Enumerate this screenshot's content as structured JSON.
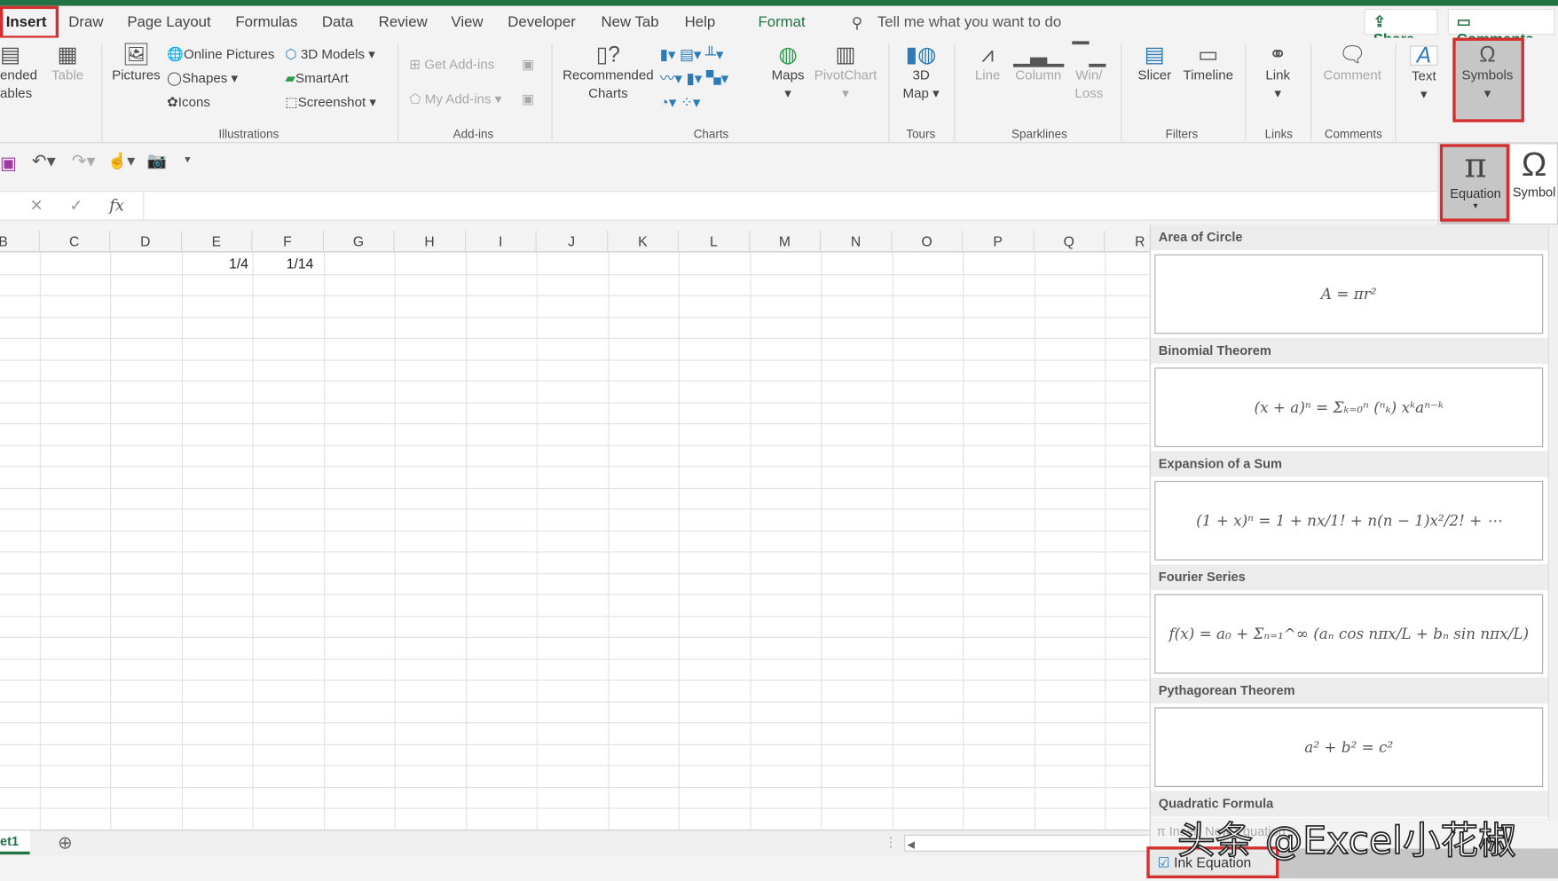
{
  "tabs": [
    "Insert",
    "Draw",
    "Page Layout",
    "Formulas",
    "Data",
    "Review",
    "View",
    "Developer",
    "New Tab",
    "Help",
    "Format"
  ],
  "active_tab": "Insert",
  "tell_me": "Tell me what you want to do",
  "share": "Share",
  "comments_btn": "Comments",
  "ribbon": {
    "tables": {
      "recommended": "ended",
      "recommended2": "ables",
      "table": "Table"
    },
    "illustrations": {
      "pictures": "Pictures",
      "online_pictures": "Online Pictures",
      "shapes": "Shapes",
      "icons": "Icons",
      "models": "3D Models",
      "smartart": "SmartArt",
      "screenshot": "Screenshot",
      "label": "Illustrations"
    },
    "addins": {
      "get": "Get Add-ins",
      "my": "My Add-ins",
      "label": "Add-ins"
    },
    "charts": {
      "recommended": "Recommended",
      "recommended2": "Charts",
      "maps": "Maps",
      "pivot": "PivotChart",
      "label": "Charts"
    },
    "tours": {
      "map": "3D",
      "map2": "Map",
      "label": "Tours"
    },
    "sparklines": {
      "line": "Line",
      "column": "Column",
      "winloss": "Win/",
      "winloss2": "Loss",
      "label": "Sparklines"
    },
    "filters": {
      "slicer": "Slicer",
      "timeline": "Timeline",
      "label": "Filters"
    },
    "links": {
      "link": "Link",
      "label": "Links"
    },
    "comments": {
      "comment": "Comment",
      "label": "Comments"
    },
    "text": {
      "text": "Text"
    },
    "symbols": {
      "symbols": "Symbols"
    }
  },
  "symbols_menu": {
    "equation": "Equation",
    "symbol": "Symbol"
  },
  "formula_bar": {
    "fx": "fx",
    "value": ""
  },
  "columns": [
    "B",
    "C",
    "D",
    "E",
    "F",
    "G",
    "H",
    "I",
    "J",
    "K",
    "L",
    "M",
    "N",
    "O",
    "P",
    "Q",
    "R"
  ],
  "cells": {
    "E1": "1/4",
    "F1": "1/14"
  },
  "sheet_tab": "et1",
  "equations": [
    {
      "title": "Area of Circle",
      "formula": "A = πr²"
    },
    {
      "title": "Binomial Theorem",
      "formula": "(x + a)ⁿ = Σₖ₌₀ⁿ (ⁿₖ) xᵏaⁿ⁻ᵏ"
    },
    {
      "title": "Expansion of a Sum",
      "formula": "(1 + x)ⁿ = 1 + nx/1! + n(n − 1)x²/2! + ⋯"
    },
    {
      "title": "Fourier Series",
      "formula": "f(x) = a₀ + Σₙ₌₁^∞ (aₙ cos nπx/L + bₙ sin nπx/L)"
    },
    {
      "title": "Pythagorean Theorem",
      "formula": "a² + b² = c²"
    },
    {
      "title": "Quadratic Formula",
      "formula": ""
    }
  ],
  "insert_new_equation": "Insert New Equation",
  "ink_equation": "Ink Equation",
  "watermark": "头条 @Excel小花椒",
  "colors": {
    "excel_green": "#217346",
    "highlight_red": "#d32f2f"
  }
}
